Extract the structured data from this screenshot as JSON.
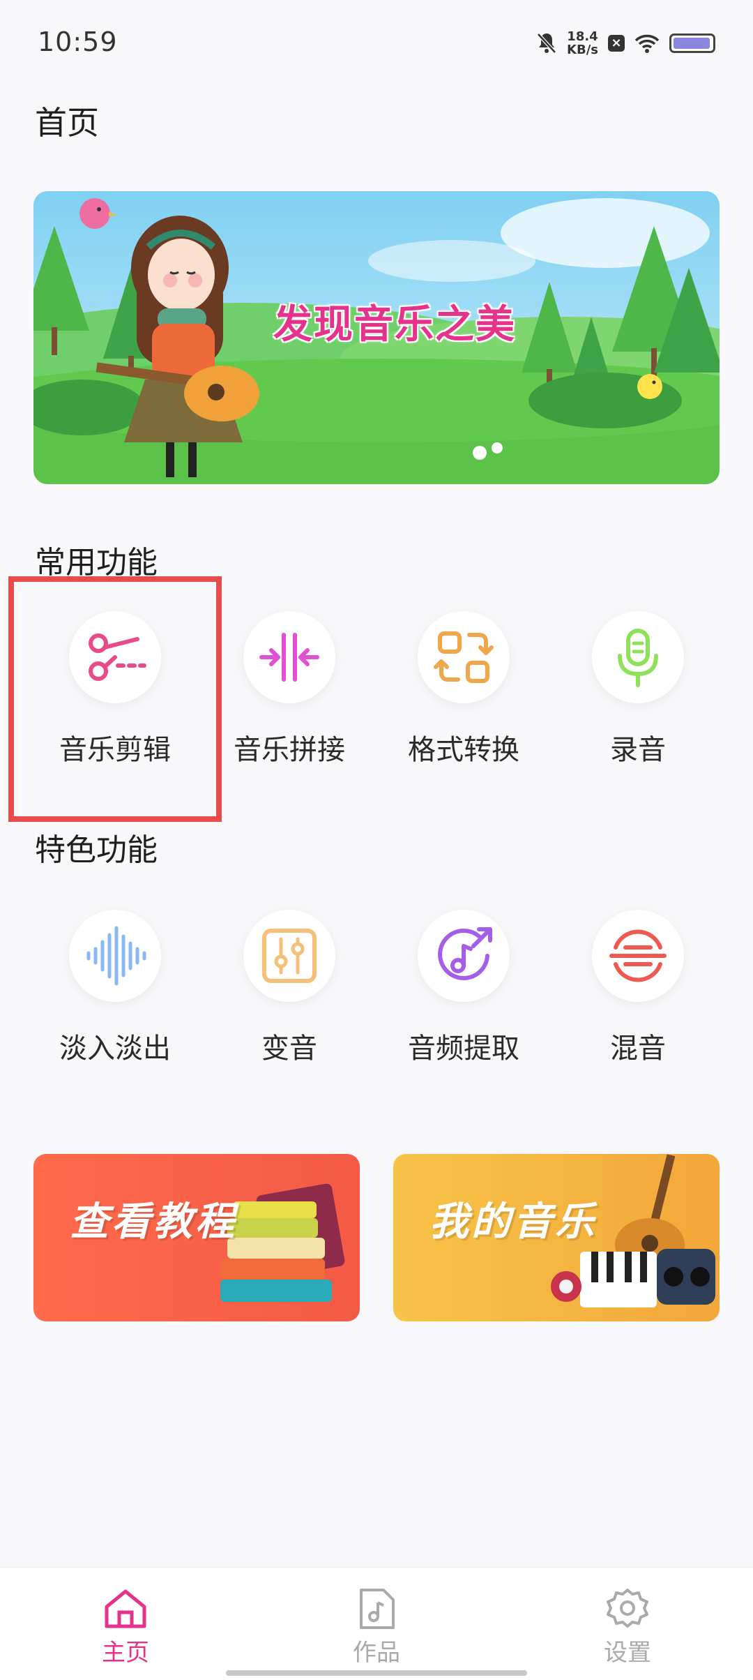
{
  "status_bar": {
    "time": "10:59",
    "speed_value": "18.4",
    "speed_unit": "KB/s",
    "icons": [
      "bell-off-icon",
      "close-box-icon",
      "wifi-icon",
      "battery-icon"
    ]
  },
  "page_title": "首页",
  "banner": {
    "slogan": "发现音乐之美"
  },
  "sections": {
    "common_title": "常用功能",
    "special_title": "特色功能"
  },
  "common_functions": [
    {
      "label": "音乐剪辑",
      "icon": "scissors-icon",
      "color": "#e94b8a"
    },
    {
      "label": "音乐拼接",
      "icon": "merge-icon",
      "color": "#e052d2"
    },
    {
      "label": "格式转换",
      "icon": "convert-icon",
      "color": "#f0a64a"
    },
    {
      "label": "录音",
      "icon": "microphone-icon",
      "color": "#8fe05a"
    }
  ],
  "special_functions": [
    {
      "label": "淡入淡出",
      "icon": "waveform-icon",
      "color": "#8ab8f0"
    },
    {
      "label": "变音",
      "icon": "equalizer-icon",
      "color": "#f4c07a"
    },
    {
      "label": "音频提取",
      "icon": "music-extract-icon",
      "color": "#a55ee8"
    },
    {
      "label": "混音",
      "icon": "mix-icon",
      "color": "#ee5a52"
    }
  ],
  "cards": {
    "tutorial": "查看教程",
    "my_music": "我的音乐"
  },
  "bottom_nav": [
    {
      "label": "主页",
      "icon": "home-icon",
      "active": true
    },
    {
      "label": "作品",
      "icon": "music-file-icon",
      "active": false
    },
    {
      "label": "设置",
      "icon": "settings-icon",
      "active": false
    }
  ],
  "colors": {
    "accent": "#e5328a",
    "highlight": "#e74c4c",
    "background": "#f8f8fa"
  }
}
